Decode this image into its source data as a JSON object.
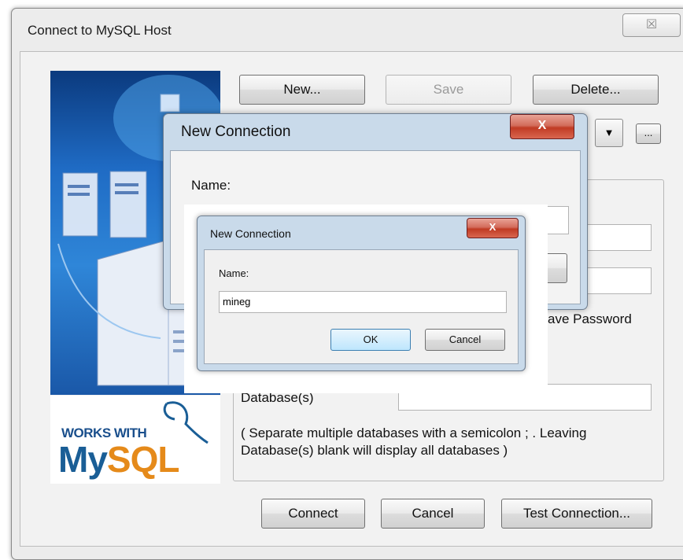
{
  "main": {
    "title": "Connect to MySQL Host",
    "close_glyph": "☒",
    "toolbar": {
      "new_label": "New...",
      "save_label": "Save",
      "delete_label": "Delete..."
    },
    "ellipsis_label": "...",
    "save_password_fragment": "ave Password",
    "database_label": "Database(s)",
    "database_hint": "( Separate multiple databases with a semicolon ; . Leaving Database(s) blank will display all databases )",
    "footer": {
      "connect_label": "Connect",
      "cancel_label": "Cancel",
      "test_label": "Test Connection..."
    }
  },
  "logo": {
    "works_with": "WORKS WITH",
    "mysql_my": "My",
    "mysql_sql": "SQL"
  },
  "dialog2": {
    "title": "New Connection",
    "name_label": "Name:",
    "close_glyph": "X"
  },
  "dialog3": {
    "title": "New Connection",
    "name_label": "Name:",
    "name_value": "mineg",
    "ok_label": "OK",
    "cancel_label": "Cancel",
    "close_glyph": "X"
  },
  "icons": [
    "close-icon",
    "dropdown-arrow-icon",
    "server-icon",
    "dolphin-icon"
  ],
  "colors": {
    "window_bg": "#ececec",
    "dialog_frame": "#c9daea",
    "close_red": "#c03b24",
    "mysql_blue": "#1a5e96",
    "mysql_orange": "#e58a1a"
  }
}
